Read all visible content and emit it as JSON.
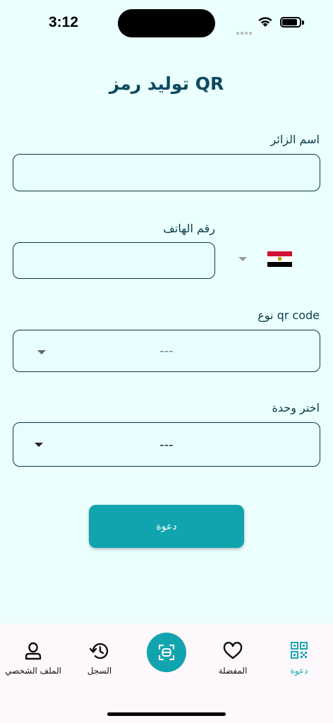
{
  "status": {
    "time": "3:12"
  },
  "page": {
    "title": "توليد رمز QR"
  },
  "form": {
    "visitor_name": {
      "label": "اسم الزائر",
      "value": ""
    },
    "phone": {
      "label": "رقم الهاتف",
      "value": "",
      "country": "Egypt"
    },
    "qr_type": {
      "label": "نوع qr code",
      "value": "---"
    },
    "unit": {
      "label": "اختر وحدة",
      "value": "---"
    }
  },
  "actions": {
    "invite_label": "دعوة"
  },
  "nav": {
    "items": [
      {
        "label": "الملف الشخصي",
        "icon": "profile-icon"
      },
      {
        "label": "السجل",
        "icon": "history-icon"
      },
      {
        "label": "",
        "icon": "scan-icon"
      },
      {
        "label": "المفضلة",
        "icon": "heart-icon"
      },
      {
        "label": "دعوة",
        "icon": "qr-icon",
        "active": true
      }
    ]
  },
  "colors": {
    "accent": "#11A4AE",
    "background": "#EAFFFE",
    "title": "#0B4A5E",
    "field_bg": "#E7FDFF"
  }
}
